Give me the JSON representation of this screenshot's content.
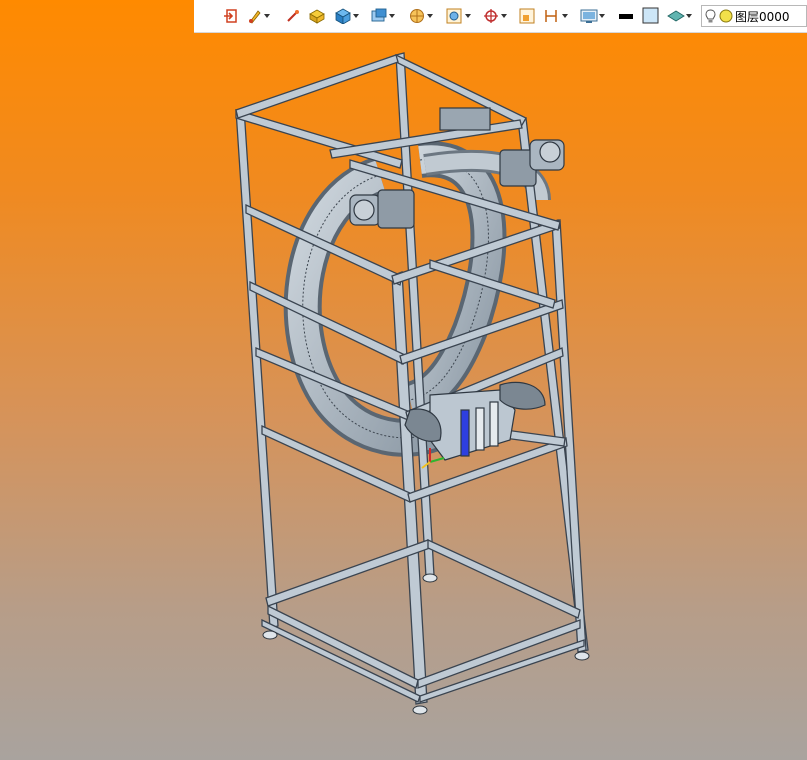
{
  "toolbar": {
    "layer": {
      "name": "图层0000"
    },
    "colors": {
      "line_color": "#000000",
      "fill_color": "#cde6f7"
    }
  },
  "viewport": {
    "background_top": "#ff8a00",
    "background_bottom": "#a9a39e",
    "model_color": "#b9c7d3",
    "model_outline": "#3a4450"
  }
}
